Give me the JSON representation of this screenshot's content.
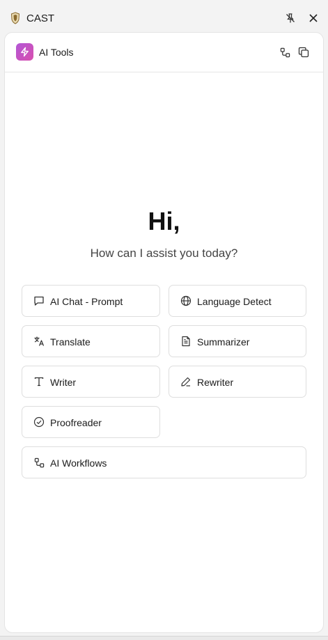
{
  "window": {
    "title": "CAST",
    "pin_icon": "pin-off-icon",
    "close_icon": "close-icon"
  },
  "header": {
    "title": "AI Tools",
    "logo_icon": "lightning-icon",
    "accent": "#c451c6",
    "actions": [
      "workflow-icon",
      "copy-icon"
    ]
  },
  "hero": {
    "greeting": "Hi,",
    "subtitle": "How can I assist you today?"
  },
  "tools": [
    {
      "label": "AI Chat - Prompt",
      "icon": "chat-icon"
    },
    {
      "label": "Language Detect",
      "icon": "globe-icon"
    },
    {
      "label": "Translate",
      "icon": "translate-icon"
    },
    {
      "label": "Summarizer",
      "icon": "document-icon"
    },
    {
      "label": "Writer",
      "icon": "text-icon"
    },
    {
      "label": "Rewriter",
      "icon": "pen-icon"
    },
    {
      "label": "Proofreader",
      "icon": "check-circle-icon"
    },
    {
      "label": "AI Workflows",
      "icon": "workflow-icon"
    }
  ]
}
